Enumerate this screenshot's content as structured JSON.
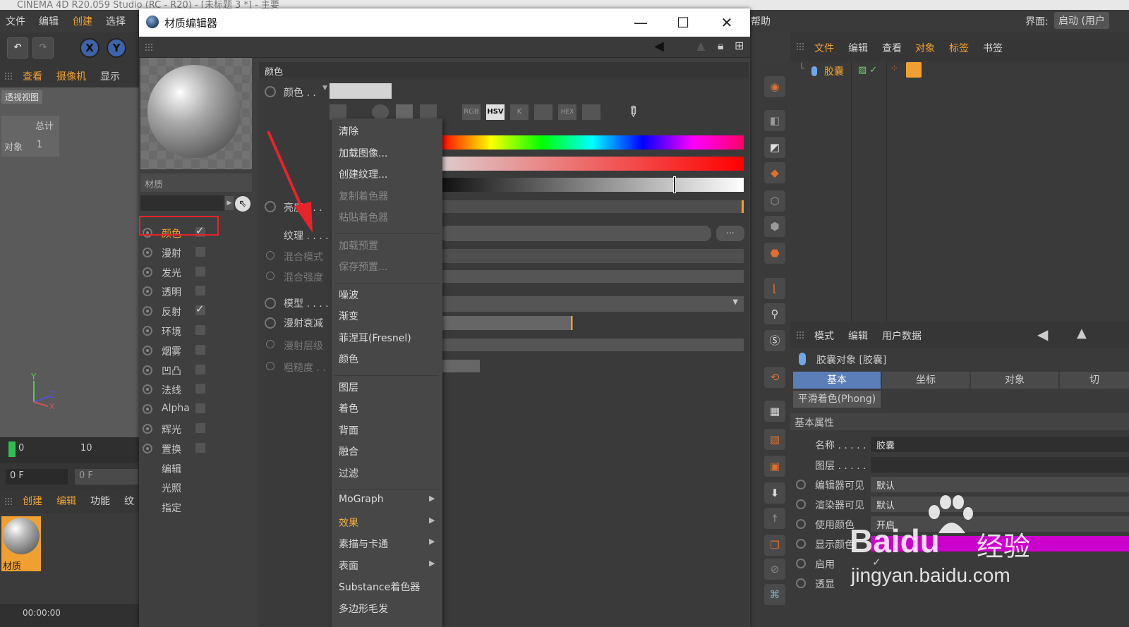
{
  "app": {
    "title": "CINEMA 4D R20.059 Studio (RC - R20) - [未标题 3 *] - 主要"
  },
  "menubar": {
    "items": [
      "文件",
      "编辑",
      "创建",
      "选择"
    ],
    "help": "帮助",
    "interface_label": "界面:",
    "interface_value": "启动 (用户"
  },
  "toolbar": {
    "axes": [
      "X",
      "Y"
    ]
  },
  "viewport": {
    "tabs": [
      "查看",
      "摄像机",
      "显示"
    ],
    "label": "透视视图",
    "total": "总计",
    "objects_label": "对象",
    "objects_count": "1"
  },
  "timeline": {
    "start": "0",
    "mark": "10",
    "frame": "0 F",
    "frame2": "0 F"
  },
  "matmgr": {
    "tabs": [
      "创建",
      "编辑",
      "功能",
      "纹"
    ],
    "material": "材质",
    "time": "00:00:00"
  },
  "editor": {
    "title": "材质编辑器",
    "material_name": "材质",
    "channels": [
      {
        "label": "颜色",
        "checked": true,
        "selected": true
      },
      {
        "label": "漫射",
        "checked": false
      },
      {
        "label": "发光",
        "checked": false
      },
      {
        "label": "透明",
        "checked": false
      },
      {
        "label": "反射",
        "checked": true
      },
      {
        "label": "环境",
        "checked": false
      },
      {
        "label": "烟雾",
        "checked": false
      },
      {
        "label": "凹凸",
        "checked": false
      },
      {
        "label": "法线",
        "checked": false
      },
      {
        "label": "Alpha",
        "checked": false
      },
      {
        "label": "辉光",
        "checked": false
      },
      {
        "label": "置换",
        "checked": false
      }
    ],
    "extra": [
      "编辑",
      "光照",
      "指定"
    ],
    "section": "颜色",
    "color_label": "颜色 . .",
    "brightness_label": "亮度 . . .",
    "texture_label": "纹理 . . . .",
    "blend_mode": "混合模式",
    "blend_strength": "混合强度",
    "model": "模型 . . . .",
    "diffuse_falloff": "漫射衰减",
    "diffuse_level": "漫射层级",
    "roughness": "粗糙度 . .",
    "modes": [
      "RGB",
      "HSV",
      "K",
      "",
      "HEX",
      ""
    ],
    "browse": "..."
  },
  "context_menu": {
    "items": [
      {
        "label": "清除",
        "state": "normal"
      },
      {
        "label": "加载图像...",
        "state": "normal"
      },
      {
        "label": "创建纹理...",
        "state": "normal"
      },
      {
        "label": "复制着色器",
        "state": "dim"
      },
      {
        "label": "粘贴着色器",
        "state": "dim"
      },
      {
        "label": "加载预置",
        "state": "dim",
        "sep": true
      },
      {
        "label": "保存预置...",
        "state": "dim"
      },
      {
        "label": "噪波",
        "state": "normal",
        "sep": true
      },
      {
        "label": "渐变",
        "state": "normal"
      },
      {
        "label": "菲涅耳(Fresnel)",
        "state": "normal"
      },
      {
        "label": "颜色",
        "state": "normal"
      },
      {
        "label": "图层",
        "state": "normal",
        "sep": true
      },
      {
        "label": "着色",
        "state": "normal"
      },
      {
        "label": "背面",
        "state": "normal"
      },
      {
        "label": "融合",
        "state": "normal"
      },
      {
        "label": "过滤",
        "state": "normal"
      },
      {
        "label": "MoGraph",
        "state": "normal",
        "sep": true,
        "sub": true
      },
      {
        "label": "效果",
        "state": "hl",
        "sub": true
      },
      {
        "label": "素描与卡通",
        "state": "normal",
        "sub": true
      },
      {
        "label": "表面",
        "state": "normal",
        "sub": true
      },
      {
        "label": "Substance着色器",
        "state": "normal"
      },
      {
        "label": "多边形毛发",
        "state": "normal"
      }
    ]
  },
  "objmgr": {
    "menu": [
      "文件",
      "编辑",
      "查看",
      "对象",
      "标签",
      "书签"
    ],
    "object": "胶囊"
  },
  "attr": {
    "menu": [
      "模式",
      "编辑",
      "用户数据"
    ],
    "object_title": "胶囊对象 [胶囊]",
    "tabs": [
      "基本",
      "坐标",
      "对象",
      "切"
    ],
    "phong_tab": "平滑着色(Phong)",
    "section": "基本属性",
    "rows": [
      {
        "label": "名称 . . . . .",
        "value": "胶囊"
      },
      {
        "label": "图层 . . . . .",
        "value": ""
      },
      {
        "label": "编辑器可见",
        "value": "默认"
      },
      {
        "label": "渲染器可见",
        "value": "默认"
      },
      {
        "label": "使用颜色",
        "value": "开启"
      },
      {
        "label": "显示颜色",
        "value": ""
      },
      {
        "label": "启用",
        "value": "✓"
      },
      {
        "label": "透显",
        "value": ""
      }
    ]
  },
  "watermark": {
    "brand": "Baidu",
    "cn": "经验",
    "url": "jingyan.baidu.com"
  },
  "colors": {
    "accent": "#f0a030",
    "selection": "#e8232a",
    "tab_active": "#5a7eb8",
    "arrow": "#e8232a"
  }
}
